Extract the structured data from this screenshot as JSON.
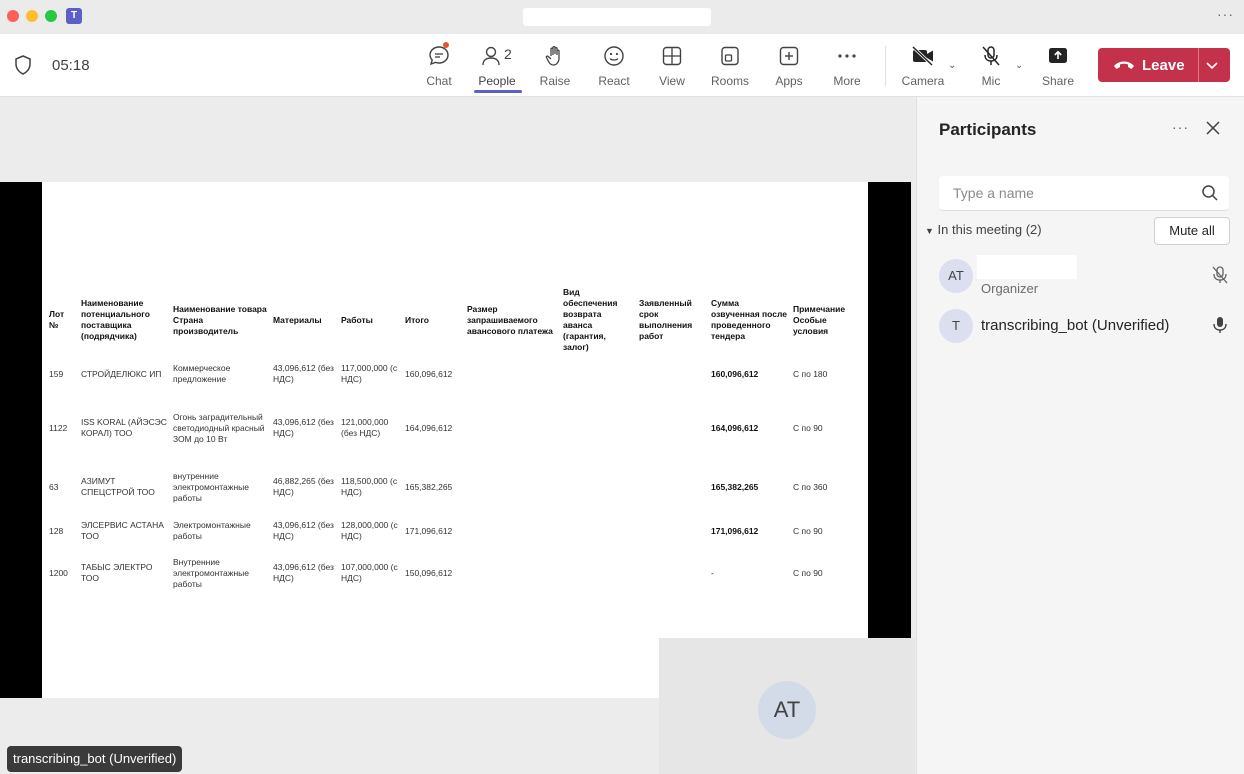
{
  "window": {
    "title_search_placeholder": ""
  },
  "toolbar": {
    "timer": "05:18",
    "people_count": "2",
    "buttons": {
      "chat": "Chat",
      "people": "People",
      "raise": "Raise",
      "react": "React",
      "view": "View",
      "rooms": "Rooms",
      "apps": "Apps",
      "more": "More",
      "camera": "Camera",
      "mic": "Mic",
      "share": "Share"
    },
    "leave": "Leave"
  },
  "shared_document": {
    "headers": [
      "Лот №",
      "Наименование потенциального поставщика (подрядчика)",
      "Наименование товара Страна производитель",
      "Материалы",
      "Работы",
      "Итого",
      "Размер запрашиваемого авансового платежа",
      "Вид обеспечения возврата аванса (гарантия, залог)",
      "Заявленный срок выполнения работ",
      "Сумма озвученная после проведенного тендера",
      "Примечание Особые условия"
    ],
    "rows": [
      {
        "lot": "159",
        "supplier": "СТРОЙДЕЛЮКС ИП",
        "goods": "Коммерческое предложение",
        "materials": "43,096,612 (без НДС)",
        "works": "117,000,000 (с НДС)",
        "total": "160,096,612",
        "advance": "",
        "security": "",
        "term": "",
        "final_sum": "160,096,612",
        "note": "С по 180"
      },
      {
        "lot": "1122",
        "supplier": "ISS KORAL (АЙЭСЭС КОРАЛ) ТОО",
        "goods": "Огонь заградительный светодиодный красный ЗОМ до 10 Вт",
        "materials": "43,096,612 (без НДС)",
        "works": "121,000,000 (без НДС)",
        "total": "164,096,612",
        "advance": "",
        "security": "",
        "term": "",
        "final_sum": "164,096,612",
        "note": "С по 90"
      },
      {
        "lot": "63",
        "supplier": "АЗИМУТ СПЕЦСТРОЙ ТОО",
        "goods": "внутренние электромонтажные работы",
        "materials": "46,882,265 (без НДС)",
        "works": "118,500,000 (с НДС)",
        "total": "165,382,265",
        "advance": "",
        "security": "",
        "term": "",
        "final_sum": "165,382,265",
        "note": "С по 360"
      },
      {
        "lot": "128",
        "supplier": "ЭЛСЕРВИС АСТАНА ТОО",
        "goods": "Электромонтажные работы",
        "materials": "43,096,612 (без НДС)",
        "works": "128,000,000 (с НДС)",
        "total": "171,096,612",
        "advance": "",
        "security": "",
        "term": "",
        "final_sum": "171,096,612",
        "note": "С по 90"
      },
      {
        "lot": "1200",
        "supplier": "ТАБЫС ЭЛЕКТРО ТОО",
        "goods": "Внутренние электромонтажные работы",
        "materials": "43,096,612 (без НДС)",
        "works": "107,000,000 (с НДС)",
        "total": "150,096,612",
        "advance": "",
        "security": "",
        "term": "",
        "final_sum": "-",
        "note": "С по 90"
      }
    ]
  },
  "self_view": {
    "initials": "AT"
  },
  "name_tag": "transcribing_bot (Unverified)",
  "panel": {
    "title": "Participants",
    "search_placeholder": "Type a name",
    "section": "In this meeting (2)",
    "mute_all": "Mute all",
    "participants": [
      {
        "initials": "AT",
        "name": "",
        "role": "Organizer",
        "mic": "muted"
      },
      {
        "initials": "T",
        "name": "transcribing_bot (Unverified)",
        "role": "",
        "mic": "on"
      }
    ]
  },
  "colors": {
    "accent": "#5b5fc7",
    "leave": "#c4314b"
  }
}
